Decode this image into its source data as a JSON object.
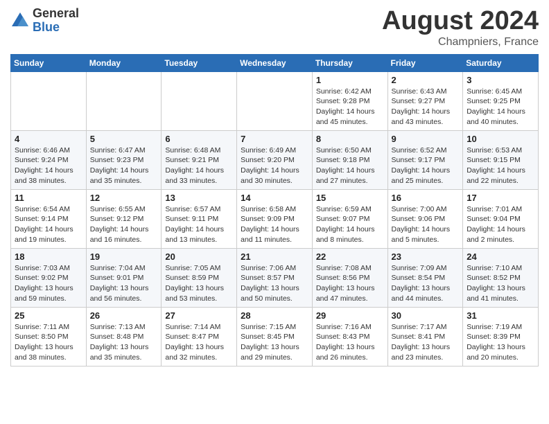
{
  "logo": {
    "general": "General",
    "blue": "Blue"
  },
  "title": {
    "month": "August 2024",
    "location": "Champniers, France"
  },
  "weekdays": [
    "Sunday",
    "Monday",
    "Tuesday",
    "Wednesday",
    "Thursday",
    "Friday",
    "Saturday"
  ],
  "weeks": [
    [
      {
        "day": "",
        "info": ""
      },
      {
        "day": "",
        "info": ""
      },
      {
        "day": "",
        "info": ""
      },
      {
        "day": "",
        "info": ""
      },
      {
        "day": "1",
        "info": "Sunrise: 6:42 AM\nSunset: 9:28 PM\nDaylight: 14 hours and 45 minutes."
      },
      {
        "day": "2",
        "info": "Sunrise: 6:43 AM\nSunset: 9:27 PM\nDaylight: 14 hours and 43 minutes."
      },
      {
        "day": "3",
        "info": "Sunrise: 6:45 AM\nSunset: 9:25 PM\nDaylight: 14 hours and 40 minutes."
      }
    ],
    [
      {
        "day": "4",
        "info": "Sunrise: 6:46 AM\nSunset: 9:24 PM\nDaylight: 14 hours and 38 minutes."
      },
      {
        "day": "5",
        "info": "Sunrise: 6:47 AM\nSunset: 9:23 PM\nDaylight: 14 hours and 35 minutes."
      },
      {
        "day": "6",
        "info": "Sunrise: 6:48 AM\nSunset: 9:21 PM\nDaylight: 14 hours and 33 minutes."
      },
      {
        "day": "7",
        "info": "Sunrise: 6:49 AM\nSunset: 9:20 PM\nDaylight: 14 hours and 30 minutes."
      },
      {
        "day": "8",
        "info": "Sunrise: 6:50 AM\nSunset: 9:18 PM\nDaylight: 14 hours and 27 minutes."
      },
      {
        "day": "9",
        "info": "Sunrise: 6:52 AM\nSunset: 9:17 PM\nDaylight: 14 hours and 25 minutes."
      },
      {
        "day": "10",
        "info": "Sunrise: 6:53 AM\nSunset: 9:15 PM\nDaylight: 14 hours and 22 minutes."
      }
    ],
    [
      {
        "day": "11",
        "info": "Sunrise: 6:54 AM\nSunset: 9:14 PM\nDaylight: 14 hours and 19 minutes."
      },
      {
        "day": "12",
        "info": "Sunrise: 6:55 AM\nSunset: 9:12 PM\nDaylight: 14 hours and 16 minutes."
      },
      {
        "day": "13",
        "info": "Sunrise: 6:57 AM\nSunset: 9:11 PM\nDaylight: 14 hours and 13 minutes."
      },
      {
        "day": "14",
        "info": "Sunrise: 6:58 AM\nSunset: 9:09 PM\nDaylight: 14 hours and 11 minutes."
      },
      {
        "day": "15",
        "info": "Sunrise: 6:59 AM\nSunset: 9:07 PM\nDaylight: 14 hours and 8 minutes."
      },
      {
        "day": "16",
        "info": "Sunrise: 7:00 AM\nSunset: 9:06 PM\nDaylight: 14 hours and 5 minutes."
      },
      {
        "day": "17",
        "info": "Sunrise: 7:01 AM\nSunset: 9:04 PM\nDaylight: 14 hours and 2 minutes."
      }
    ],
    [
      {
        "day": "18",
        "info": "Sunrise: 7:03 AM\nSunset: 9:02 PM\nDaylight: 13 hours and 59 minutes."
      },
      {
        "day": "19",
        "info": "Sunrise: 7:04 AM\nSunset: 9:01 PM\nDaylight: 13 hours and 56 minutes."
      },
      {
        "day": "20",
        "info": "Sunrise: 7:05 AM\nSunset: 8:59 PM\nDaylight: 13 hours and 53 minutes."
      },
      {
        "day": "21",
        "info": "Sunrise: 7:06 AM\nSunset: 8:57 PM\nDaylight: 13 hours and 50 minutes."
      },
      {
        "day": "22",
        "info": "Sunrise: 7:08 AM\nSunset: 8:56 PM\nDaylight: 13 hours and 47 minutes."
      },
      {
        "day": "23",
        "info": "Sunrise: 7:09 AM\nSunset: 8:54 PM\nDaylight: 13 hours and 44 minutes."
      },
      {
        "day": "24",
        "info": "Sunrise: 7:10 AM\nSunset: 8:52 PM\nDaylight: 13 hours and 41 minutes."
      }
    ],
    [
      {
        "day": "25",
        "info": "Sunrise: 7:11 AM\nSunset: 8:50 PM\nDaylight: 13 hours and 38 minutes."
      },
      {
        "day": "26",
        "info": "Sunrise: 7:13 AM\nSunset: 8:48 PM\nDaylight: 13 hours and 35 minutes."
      },
      {
        "day": "27",
        "info": "Sunrise: 7:14 AM\nSunset: 8:47 PM\nDaylight: 13 hours and 32 minutes."
      },
      {
        "day": "28",
        "info": "Sunrise: 7:15 AM\nSunset: 8:45 PM\nDaylight: 13 hours and 29 minutes."
      },
      {
        "day": "29",
        "info": "Sunrise: 7:16 AM\nSunset: 8:43 PM\nDaylight: 13 hours and 26 minutes."
      },
      {
        "day": "30",
        "info": "Sunrise: 7:17 AM\nSunset: 8:41 PM\nDaylight: 13 hours and 23 minutes."
      },
      {
        "day": "31",
        "info": "Sunrise: 7:19 AM\nSunset: 8:39 PM\nDaylight: 13 hours and 20 minutes."
      }
    ]
  ]
}
